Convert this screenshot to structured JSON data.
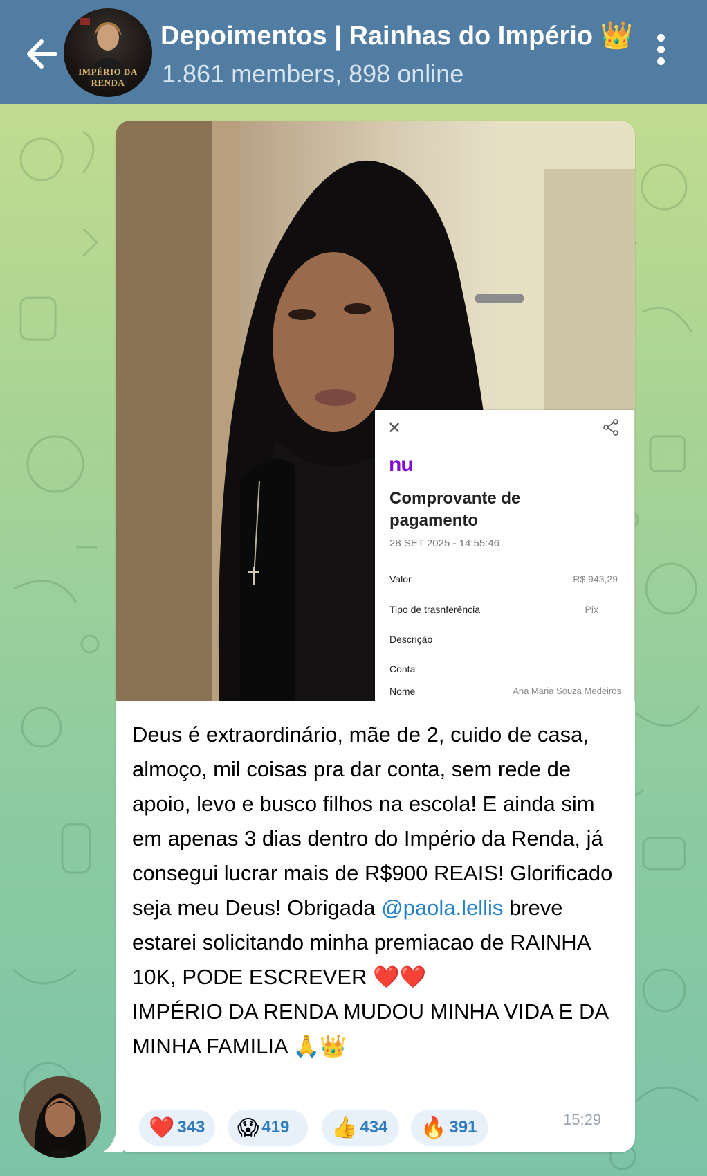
{
  "header": {
    "back_icon": "arrow-left-icon",
    "title": "Depoimentos | Rainhas do Império 👑",
    "subtitle": "1.861 members, 898 online",
    "avatar_text": "IMPÉRIO DA RENDA",
    "menu_icon": "kebab-menu-icon"
  },
  "message": {
    "receipt": {
      "logo": "nu",
      "title": "Comprovante de pagamento",
      "date": "28 SET 2025 - 14:55:46",
      "rows": [
        {
          "label": "Valor",
          "value": "R$ 943,29"
        },
        {
          "label": "Tipo de trasnferência",
          "value": "Pix"
        },
        {
          "label": "Descrição",
          "value": ""
        },
        {
          "label": "Conta",
          "value": ""
        },
        {
          "label": "Nome",
          "value": "Ana Maria Souza Medeiros"
        }
      ]
    },
    "text_before_mention": "Deus é extraordinário, mãe de 2, cuido de casa, almoço, mil coisas pra dar conta, sem rede de apoio, levo e busco filhos na escola! E ainda sim em apenas 3 dias dentro do Império da Renda, já consegui lucrar mais de R$900 REAIS! Glorificado seja meu Deus! Obrigada ",
    "mention": "@paola.lellis",
    "text_after_mention": " breve estarei solicitando minha premiacao de RAINHA 10K, PODE ESCREVER ❤️❤️",
    "text_last": "IMPÉRIO DA RENDA MUDOU MINHA VIDA E DA MINHA FAMILIA 🙏👑",
    "reactions": [
      {
        "emoji": "❤️",
        "count": "343"
      },
      {
        "emoji": "😱",
        "count": "419"
      },
      {
        "emoji": "👍",
        "count": "434"
      },
      {
        "emoji": "🔥",
        "count": "391"
      }
    ],
    "time": "15:29"
  },
  "colors": {
    "header_bg": "#527da3",
    "mention": "#2481cc",
    "reaction_bg": "#e8f1fa",
    "reaction_count": "#2f7bbf"
  }
}
